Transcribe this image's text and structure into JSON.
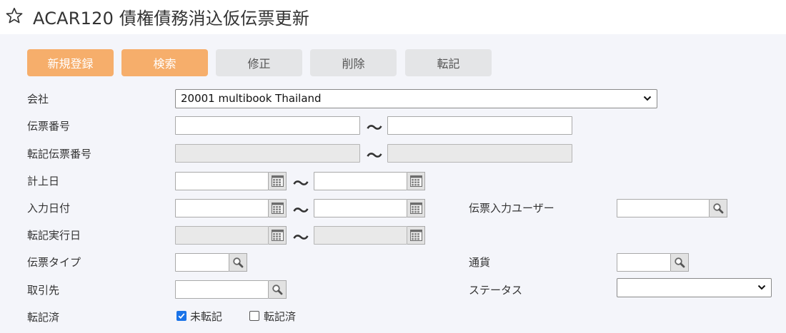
{
  "header": {
    "title": "ACAR120 債権債務消込仮伝票更新",
    "star_icon": "star-outline-icon"
  },
  "toolbar": {
    "new_label": "新規登録",
    "search_label": "検索",
    "edit_label": "修正",
    "delete_label": "削除",
    "post_label": "転記"
  },
  "form": {
    "company": {
      "label": "会社",
      "value": "20001 multibook Thailand"
    },
    "voucher_no": {
      "label": "伝票番号",
      "from": "",
      "to": ""
    },
    "posted_voucher_no": {
      "label": "転記伝票番号"
    },
    "booking_date": {
      "label": "計上日"
    },
    "input_date": {
      "label": "入力日付"
    },
    "post_exec_date": {
      "label": "転記実行日"
    },
    "voucher_type": {
      "label": "伝票タイプ"
    },
    "partner": {
      "label": "取引先"
    },
    "voucher_input_user": {
      "label": "伝票入力ユーザー"
    },
    "currency": {
      "label": "通貨"
    },
    "status": {
      "label": "ステータス",
      "value": ""
    },
    "posted": {
      "label": "転記済",
      "options": [
        {
          "label": "未転記",
          "checked": true
        },
        {
          "label": "転記済",
          "checked": false
        }
      ]
    },
    "range_separator": "～"
  },
  "colors": {
    "primary": "#f6ae6b",
    "disabled": "#e4e5e7",
    "checkbox": "#1a73e8"
  }
}
